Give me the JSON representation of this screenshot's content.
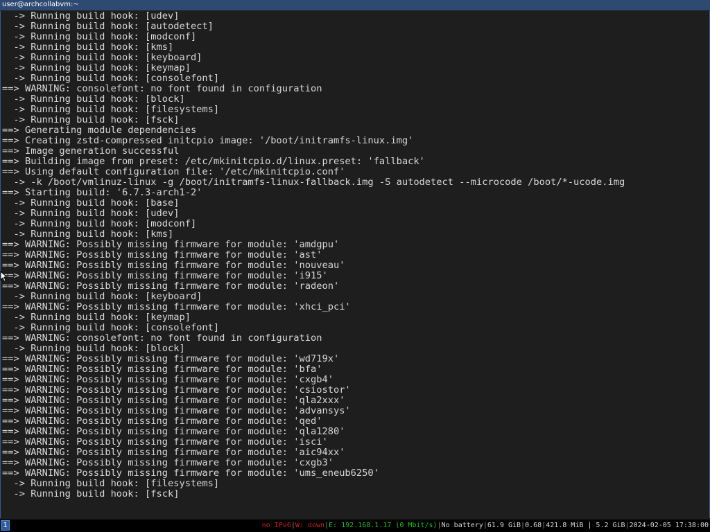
{
  "window": {
    "title": "user@archcollabvm:~"
  },
  "terminal": {
    "lines": [
      "  -> Running build hook: [udev]",
      "  -> Running build hook: [autodetect]",
      "  -> Running build hook: [modconf]",
      "  -> Running build hook: [kms]",
      "  -> Running build hook: [keyboard]",
      "  -> Running build hook: [keymap]",
      "  -> Running build hook: [consolefont]",
      "==> WARNING: consolefont: no font found in configuration",
      "  -> Running build hook: [block]",
      "  -> Running build hook: [filesystems]",
      "  -> Running build hook: [fsck]",
      "==> Generating module dependencies",
      "==> Creating zstd-compressed initcpio image: '/boot/initramfs-linux.img'",
      "==> Image generation successful",
      "==> Building image from preset: /etc/mkinitcpio.d/linux.preset: 'fallback'",
      "==> Using default configuration file: '/etc/mkinitcpio.conf'",
      "  -> -k /boot/vmlinuz-linux -g /boot/initramfs-linux-fallback.img -S autodetect --microcode /boot/*-ucode.img",
      "==> Starting build: '6.7.3-arch1-2'",
      "  -> Running build hook: [base]",
      "  -> Running build hook: [udev]",
      "  -> Running build hook: [modconf]",
      "  -> Running build hook: [kms]",
      "==> WARNING: Possibly missing firmware for module: 'amdgpu'",
      "==> WARNING: Possibly missing firmware for module: 'ast'",
      "==> WARNING: Possibly missing firmware for module: 'nouveau'",
      "==> WARNING: Possibly missing firmware for module: 'i915'",
      "==> WARNING: Possibly missing firmware for module: 'radeon'",
      "  -> Running build hook: [keyboard]",
      "==> WARNING: Possibly missing firmware for module: 'xhci_pci'",
      "  -> Running build hook: [keymap]",
      "  -> Running build hook: [consolefont]",
      "==> WARNING: consolefont: no font found in configuration",
      "  -> Running build hook: [block]",
      "==> WARNING: Possibly missing firmware for module: 'wd719x'",
      "==> WARNING: Possibly missing firmware for module: 'bfa'",
      "==> WARNING: Possibly missing firmware for module: 'cxgb4'",
      "==> WARNING: Possibly missing firmware for module: 'csiostor'",
      "==> WARNING: Possibly missing firmware for module: 'qla2xxx'",
      "==> WARNING: Possibly missing firmware for module: 'advansys'",
      "==> WARNING: Possibly missing firmware for module: 'qed'",
      "==> WARNING: Possibly missing firmware for module: 'qla1280'",
      "==> WARNING: Possibly missing firmware for module: 'isci'",
      "==> WARNING: Possibly missing firmware for module: 'aic94xx'",
      "==> WARNING: Possibly missing firmware for module: 'cxgb3'",
      "==> WARNING: Possibly missing firmware for module: 'ums_eneub6250'",
      "  -> Running build hook: [filesystems]",
      "  -> Running build hook: [fsck]"
    ]
  },
  "statusbar": {
    "workspace": "1",
    "ipv6": "no IPv6",
    "wifi": "W: down",
    "ethernet": "E: 192.168.1.17 (0 Mbit/s)",
    "battery": "No battery",
    "disk": "61.9 GiB",
    "load": "0.68",
    "memory": "421.8 MiB | 5.2 GiB",
    "datetime": "2024-02-05 17:38:00",
    "colors": {
      "bad": "#cc2222",
      "good": "#22bb22",
      "normal": "#d8d8d8"
    }
  }
}
